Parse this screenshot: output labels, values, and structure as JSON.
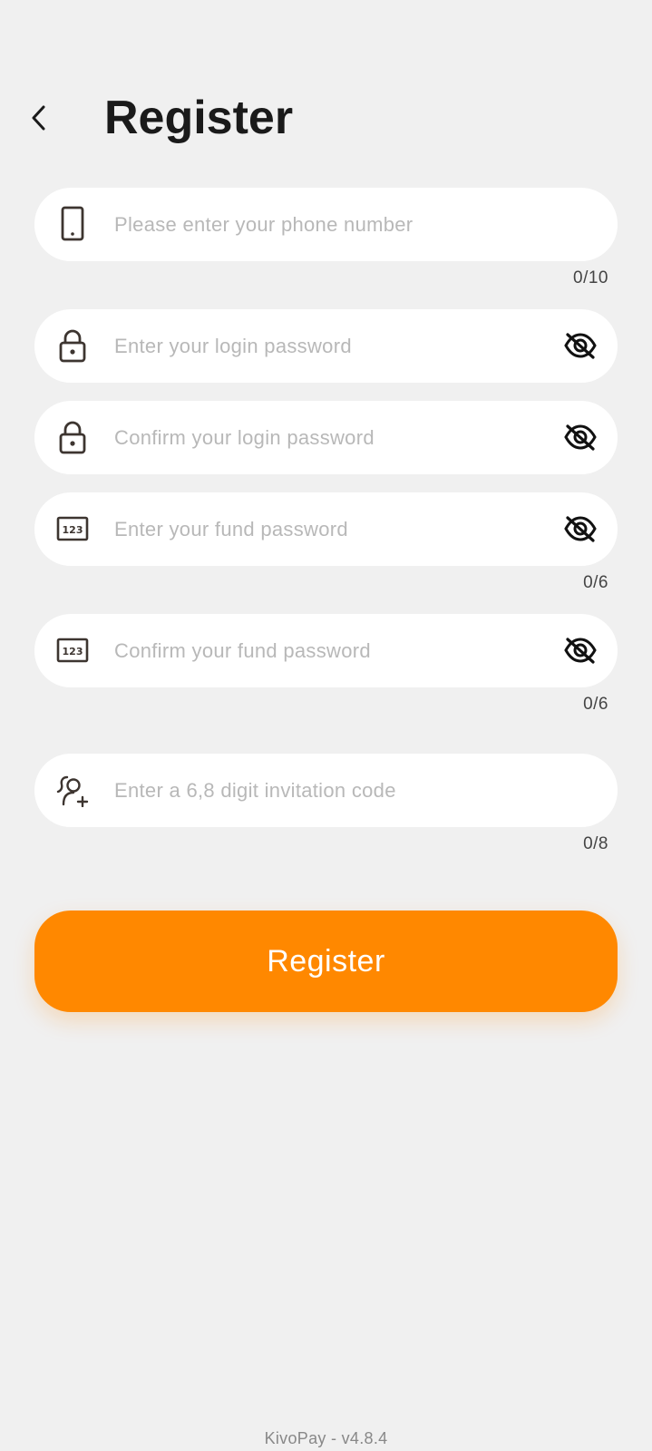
{
  "header": {
    "title": "Register"
  },
  "form": {
    "phone": {
      "placeholder": "Please enter your phone number",
      "value": "",
      "counter": "0/10",
      "icon": "phone-icon"
    },
    "login_password": {
      "placeholder": "Enter your login password",
      "value": "",
      "icon": "lock-icon",
      "visibility_icon": "eye-off-icon"
    },
    "confirm_login_password": {
      "placeholder": "Confirm your login password",
      "value": "",
      "icon": "lock-icon",
      "visibility_icon": "eye-off-icon"
    },
    "fund_password": {
      "placeholder": "Enter your fund password",
      "value": "",
      "counter": "0/6",
      "icon": "numeric-123-icon",
      "visibility_icon": "eye-off-icon"
    },
    "confirm_fund_password": {
      "placeholder": "Confirm your fund password",
      "value": "",
      "counter": "0/6",
      "icon": "numeric-123-icon",
      "visibility_icon": "eye-off-icon"
    },
    "invitation_code": {
      "placeholder": "Enter a 6,8 digit invitation code",
      "value": "",
      "counter": "0/8",
      "icon": "add-user-icon"
    }
  },
  "register_button": {
    "label": "Register",
    "color": "#ff8800"
  },
  "footer": {
    "version": "KivoPay - v4.8.4"
  }
}
